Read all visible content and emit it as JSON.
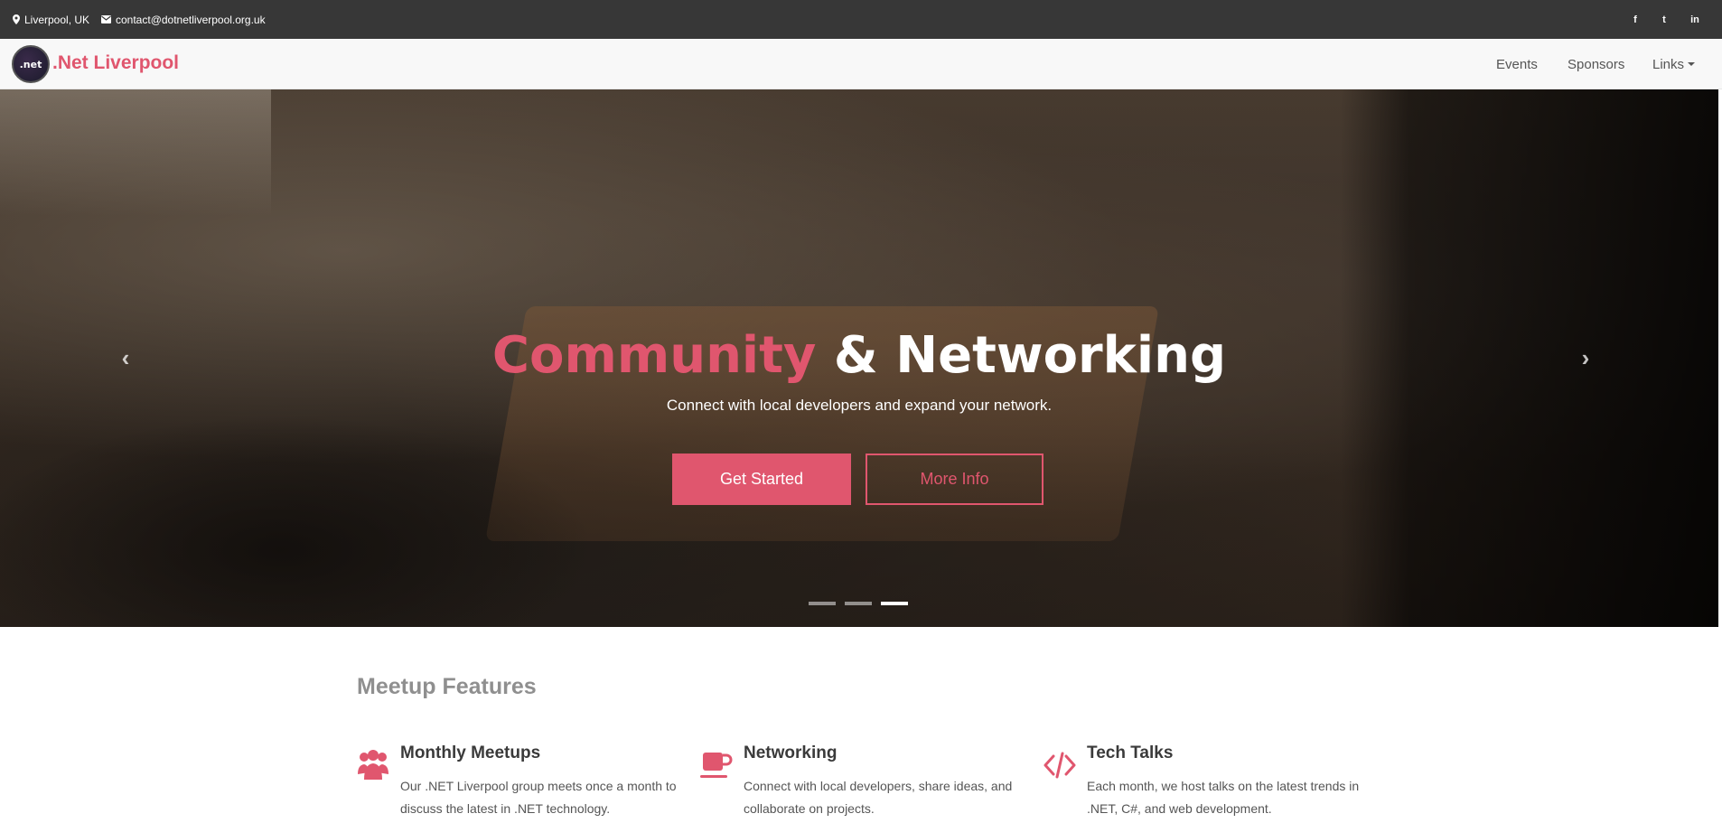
{
  "topbar": {
    "location": "Liverpool, UK",
    "email": "contact@dotnetliverpool.org.uk",
    "social": [
      {
        "icon": "facebook-icon",
        "glyph": "f"
      },
      {
        "icon": "twitter-icon",
        "glyph": "t"
      },
      {
        "icon": "linkedin-icon",
        "glyph": "in"
      }
    ]
  },
  "nav": {
    "logo_text": ".net",
    "brand": ".Net Liverpool",
    "links": [
      "Events",
      "Sponsors",
      "Links"
    ]
  },
  "hero": {
    "title_accent": "Community",
    "title_rest": " & Networking",
    "subtitle": "Connect with local developers and expand your network.",
    "primary_button": "Get Started",
    "secondary_button": "More Info",
    "prev_glyph": "‹",
    "next_glyph": "›",
    "slides_count": 3,
    "active_slide": 3
  },
  "features": {
    "title": "Meetup Features",
    "items": [
      {
        "icon": "users-icon",
        "title": "Monthly Meetups",
        "text": "Our .NET Liverpool group meets once a month to discuss the latest in .NET technology."
      },
      {
        "icon": "coffee-icon",
        "title": "Networking",
        "text": "Connect with local developers, share ideas, and collaborate on projects."
      },
      {
        "icon": "code-icon",
        "title": "Tech Talks",
        "text": "Each month, we host talks on the latest trends in .NET, C#, and web development."
      }
    ]
  },
  "colors": {
    "accent": "#e0566e",
    "topbar": "#373737",
    "navbar": "#f8f8f8"
  }
}
